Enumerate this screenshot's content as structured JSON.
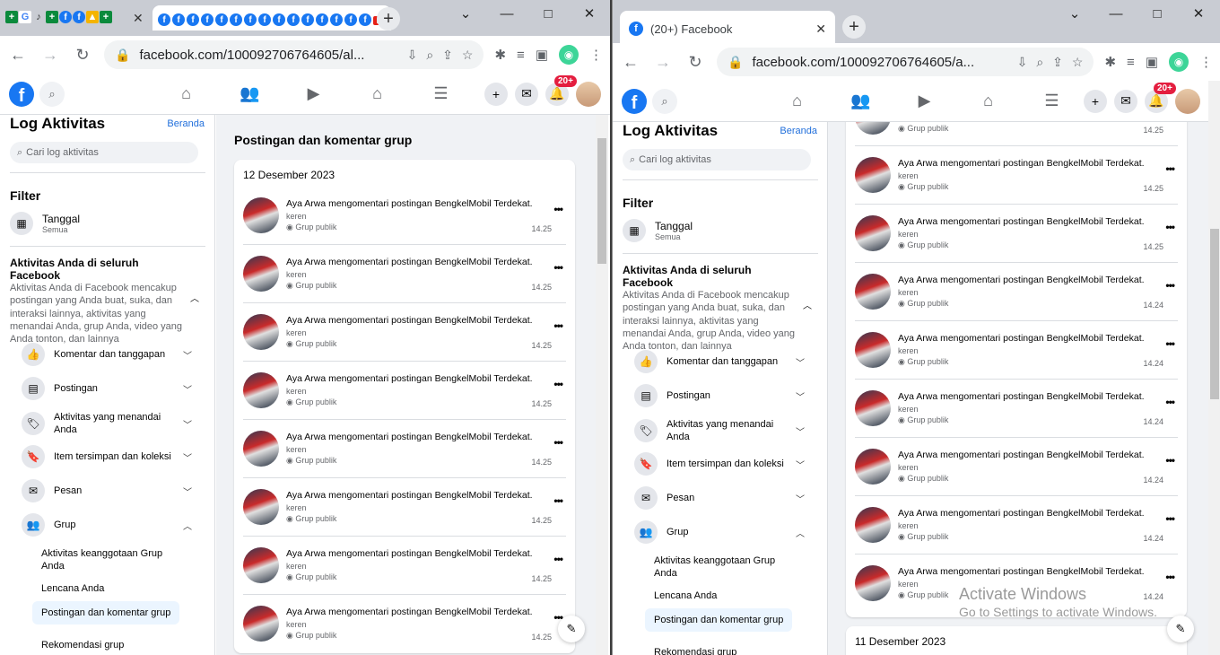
{
  "colors": {
    "fb_blue": "#1877f2",
    "link": "#216fdb",
    "badge": "#e41e3f",
    "selected_bg": "#ebf5ff"
  },
  "left_window": {
    "tab_icons": [
      "+",
      "G",
      "♪",
      "+",
      "f",
      "f",
      "▲",
      "+"
    ],
    "tab_group_icons": [
      "f",
      "f",
      "f",
      "f",
      "f",
      "f",
      "f",
      "f",
      "f",
      "f",
      "f",
      "f",
      "f",
      "f",
      "f",
      "▶"
    ],
    "url": "facebook.com/100092706764605/al...",
    "window_controls": [
      "⌄",
      "—",
      "□",
      "✕"
    ]
  },
  "right_window": {
    "tab_title": "(20+) Facebook",
    "url": "facebook.com/100092706764605/a...",
    "window_controls": [
      "⌄",
      "—",
      "□",
      "✕"
    ]
  },
  "header": {
    "badge": "20+",
    "nav_icons": [
      "home-icon",
      "friends-icon",
      "watch-icon",
      "marketplace-icon",
      "menu-icon"
    ]
  },
  "sidebar": {
    "title": "Log Aktivitas",
    "home_link": "Beranda",
    "search_placeholder": "Cari log aktivitas",
    "filter_title": "Filter",
    "date_filter": {
      "label": "Tanggal",
      "value": "Semua"
    },
    "all_activity": {
      "title": "Aktivitas Anda di seluruh Facebook",
      "desc": "Aktivitas Anda di Facebook mencakup postingan yang Anda buat, suka, dan interaksi lainnya, aktivitas yang menandai Anda, grup Anda, video yang Anda tonton, dan lainnya"
    },
    "categories": [
      {
        "label": "Komentar dan tanggapan",
        "icon": "like-icon"
      },
      {
        "label": "Postingan",
        "icon": "post-icon"
      },
      {
        "label": "Aktivitas yang menandai Anda",
        "icon": "tag-icon"
      },
      {
        "label": "Item tersimpan dan koleksi",
        "icon": "bookmark-icon"
      },
      {
        "label": "Pesan",
        "icon": "messenger-icon"
      },
      {
        "label": "Grup",
        "icon": "group-icon"
      }
    ],
    "group_sub": [
      "Aktivitas keanggotaan Grup Anda",
      "Lencana Anda",
      "Postingan dan komentar grup",
      "Rekomendasi grup"
    ]
  },
  "main": {
    "title": "Postingan dan komentar grup",
    "date1": "12 Desember 2023",
    "date2": "11 Desember 2023",
    "item_text": "Aya Arwa mengomentari postingan BengkelMobil Terdekat.",
    "item_comment": "keren",
    "item_privacy": "Grup publik",
    "left_times": [
      "14.25",
      "14.25",
      "14.25",
      "14.25",
      "14.25",
      "14.25",
      "14.25",
      "14.25"
    ],
    "right_times": [
      "14.25",
      "14.25",
      "14.25",
      "14.24",
      "14.24",
      "14.24",
      "14.24",
      "14.24",
      "14.24"
    ]
  },
  "watermark": {
    "line1": "Activate Windows",
    "line2": "Go to Settings to activate Windows."
  }
}
